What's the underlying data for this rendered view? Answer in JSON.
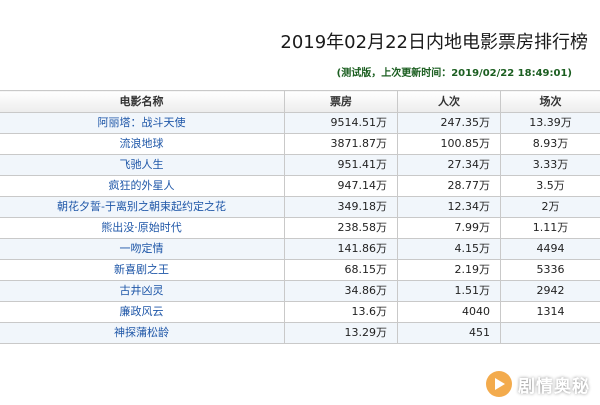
{
  "title": "2019年02月22日内地电影票房排行榜",
  "subtitle": "(测试版，上次更新时间：2019/02/22 18:49:01)",
  "columns": [
    "电影名称",
    "票房",
    "人次",
    "场次"
  ],
  "rows": [
    {
      "name": "阿丽塔：战斗天使",
      "box": "9514.51万",
      "people": "247.35万",
      "shows": "13.39万"
    },
    {
      "name": "流浪地球",
      "box": "3871.87万",
      "people": "100.85万",
      "shows": "8.93万"
    },
    {
      "name": "飞驰人生",
      "box": "951.41万",
      "people": "27.34万",
      "shows": "3.33万"
    },
    {
      "name": "疯狂的外星人",
      "box": "947.14万",
      "people": "28.77万",
      "shows": "3.5万"
    },
    {
      "name": "朝花夕誓-于离别之朝束起约定之花",
      "box": "349.18万",
      "people": "12.34万",
      "shows": "2万"
    },
    {
      "name": "熊出没·原始时代",
      "box": "238.58万",
      "people": "7.99万",
      "shows": "1.11万"
    },
    {
      "name": "一吻定情",
      "box": "141.86万",
      "people": "4.15万",
      "shows": "4494"
    },
    {
      "name": "新喜剧之王",
      "box": "68.15万",
      "people": "2.19万",
      "shows": "5336"
    },
    {
      "name": "古井凶灵",
      "box": "34.86万",
      "people": "1.51万",
      "shows": "2942"
    },
    {
      "name": "廉政风云",
      "box": "13.6万",
      "people": "4040",
      "shows": "1314"
    },
    {
      "name": "神探蒲松龄",
      "box": "13.29万",
      "people": "451",
      "shows": ""
    }
  ],
  "watermark": {
    "text": "剧情奥秘",
    "icon": "play-icon"
  }
}
